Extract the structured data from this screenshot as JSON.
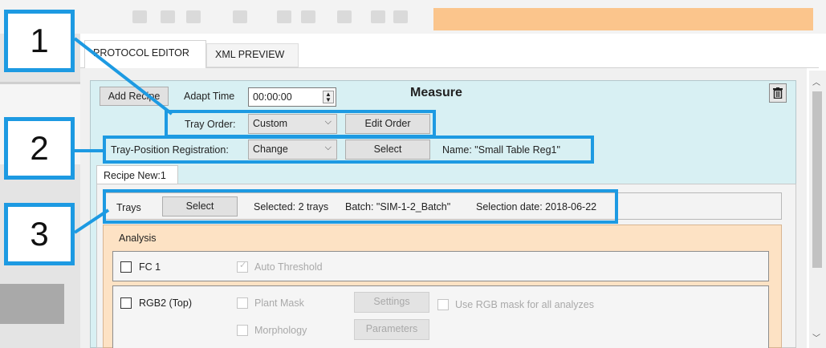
{
  "tabs": {
    "protocol_editor": "PROTOCOL EDITOR",
    "xml_preview": "XML PREVIEW"
  },
  "measure": {
    "title": "Measure",
    "add_recipe": "Add Recipe",
    "adapt_time_label": "Adapt Time",
    "adapt_time_value": "00:00:00",
    "tray_order_label": "Tray Order:",
    "tray_order_value": "Custom",
    "edit_order": "Edit Order",
    "reg_label": "Tray-Position Registration:",
    "reg_value": "Change",
    "reg_select": "Select",
    "reg_name": "Name: \"Small Table Reg1\""
  },
  "recipe": {
    "tab_label": "Recipe New:1",
    "trays_label": "Trays",
    "trays_select": "Select",
    "selected": "Selected: 2 trays",
    "batch": "Batch: \"SIM-1-2_Batch\"",
    "selection_date": "Selection date: 2018-06-22"
  },
  "analysis": {
    "title": "Analysis",
    "fc1": "FC 1",
    "auto_threshold": "Auto Threshold",
    "rgb2": "RGB2 (Top)",
    "plant_mask": "Plant Mask",
    "settings": "Settings",
    "use_rgb_mask": "Use RGB mask for all analyzes",
    "morphology": "Morphology",
    "parameters": "Parameters"
  },
  "callouts": [
    "1",
    "2",
    "3"
  ],
  "icons": {
    "trash": "trash-icon",
    "dropdown": "chevron-down-icon",
    "spinner": "spinner-icon"
  },
  "colors": {
    "highlight": "#1d9ae2",
    "measure_panel": "#d8f0f3",
    "analysis_panel": "#fde2c4"
  }
}
